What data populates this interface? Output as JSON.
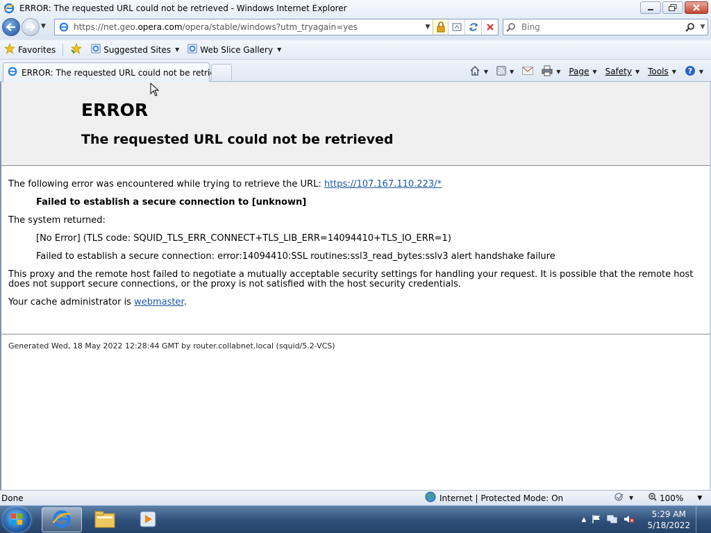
{
  "window": {
    "title": "ERROR: The requested URL could not be retrieved - Windows Internet Explorer"
  },
  "address": {
    "url_prefix": "https://net.geo.",
    "url_domain": "opera.com",
    "url_suffix": "/opera/stable/windows?utm_tryagain=yes"
  },
  "search": {
    "placeholder": "Bing"
  },
  "favorites": {
    "favorites_label": "Favorites",
    "suggested_label": "Suggested Sites",
    "webslice_label": "Web Slice Gallery"
  },
  "tab": {
    "label": "ERROR: The requested URL could not be retrieved"
  },
  "commandbar": {
    "page": "Page",
    "safety": "Safety",
    "tools": "Tools"
  },
  "page": {
    "heading": "ERROR",
    "subheading": "The requested URL could not be retrieved",
    "intro": "The following error was encountered while trying to retrieve the URL: ",
    "intro_link": "https://107.167.110.223/*",
    "failed": "Failed to establish a secure connection to [unknown]",
    "system_returned": "The system returned:",
    "no_error": "[No Error] (TLS code: SQUID_TLS_ERR_CONNECT+TLS_LIB_ERR=14094410+TLS_IO_ERR=1)",
    "ssl_error": "Failed to establish a secure connection: error:14094410:SSL routines:ssl3_read_bytes:sslv3 alert handshake failure",
    "explanation": "This proxy and the remote host failed to negotiate a mutually acceptable security settings for handling your request. It is possible that the remote host does not support secure connections, or the proxy is not satisfied with the host security credentials.",
    "admin_prefix": "Your cache administrator is ",
    "admin_link": "webmaster",
    "admin_suffix": ".",
    "footer": "Generated Wed, 18 May 2022 12:28:44 GMT by router.collabnet.local (squid/5.2-VCS)"
  },
  "status": {
    "text": "Done",
    "zone": "Internet | Protected Mode: On",
    "zoom": "100%"
  },
  "clock": {
    "time": "5:29 AM",
    "date": "5/18/2022"
  }
}
